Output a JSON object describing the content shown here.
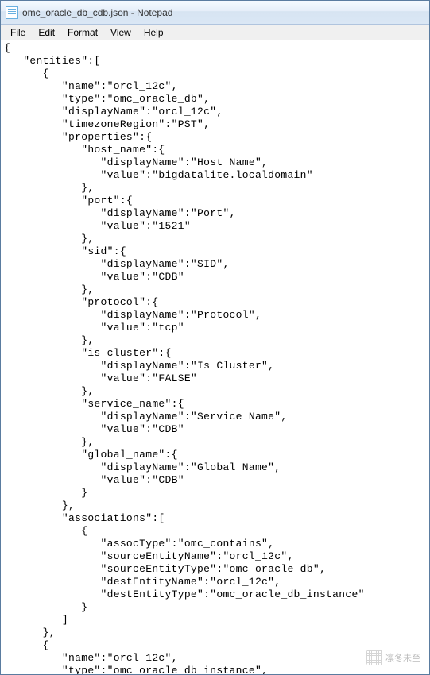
{
  "window": {
    "title": "omc_oracle_db_cdb.json - Notepad"
  },
  "menu": {
    "file": "File",
    "edit": "Edit",
    "format": "Format",
    "view": "View",
    "help": "Help"
  },
  "content": "{\n   \"entities\":[\n      {\n         \"name\":\"orcl_12c\",\n         \"type\":\"omc_oracle_db\",\n         \"displayName\":\"orcl_12c\",\n         \"timezoneRegion\":\"PST\",\n         \"properties\":{\n            \"host_name\":{\n               \"displayName\":\"Host Name\",\n               \"value\":\"bigdatalite.localdomain\"\n            },\n            \"port\":{\n               \"displayName\":\"Port\",\n               \"value\":\"1521\"\n            },\n            \"sid\":{\n               \"displayName\":\"SID\",\n               \"value\":\"CDB\"\n            },\n            \"protocol\":{\n               \"displayName\":\"Protocol\",\n               \"value\":\"tcp\"\n            },\n            \"is_cluster\":{\n               \"displayName\":\"Is Cluster\",\n               \"value\":\"FALSE\"\n            },\n            \"service_name\":{\n               \"displayName\":\"Service Name\",\n               \"value\":\"CDB\"\n            },\n            \"global_name\":{\n               \"displayName\":\"Global Name\",\n               \"value\":\"CDB\"\n            }\n         },\n         \"associations\":[\n            {\n               \"assocType\":\"omc_contains\",\n               \"sourceEntityName\":\"orcl_12c\",\n               \"sourceEntityType\":\"omc_oracle_db\",\n               \"destEntityName\":\"orcl_12c\",\n               \"destEntityType\":\"omc_oracle_db_instance\"\n            }\n         ]\n      },\n      {\n         \"name\":\"orcl_12c\",\n         \"type\":\"omc_oracle_db_instance\",\n         \"displayName\":\"orcl_12c\",\n         \"timezoneRegion\":\"PST\",\n         \"properties\":{\n            \"host_name\":{\n               \"displayName\":\"Host Name\",\n               \"value\":\"bigdatalite.localdomain\"\n            },\n            \"audit_dest\":{\n               \"displayName\":\"Audit Dest\",\n               \"value\":\"/u01/app/oracle/admin/cdb/adum",
  "watermark": "凛冬未至"
}
